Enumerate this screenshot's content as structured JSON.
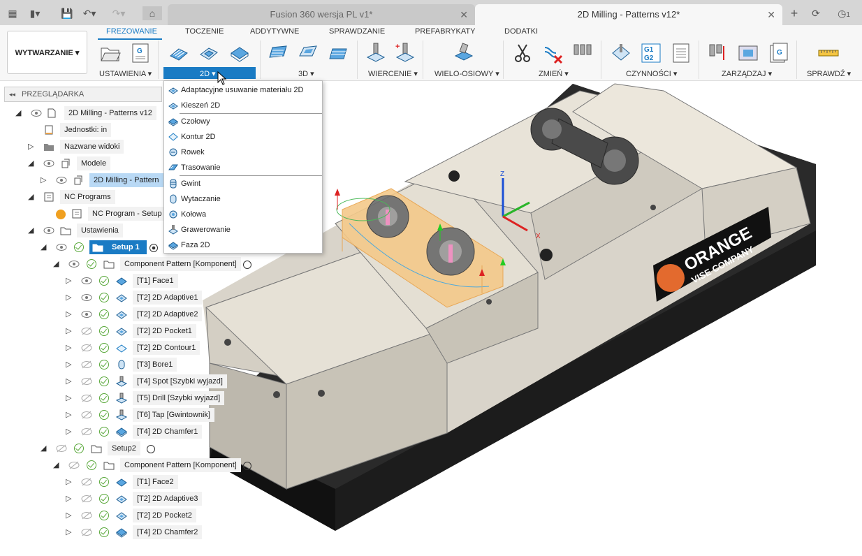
{
  "titlebar": {
    "tab1_title": "Fusion 360 wersja PL v1*",
    "tab2_title": "2D Milling - Patterns v12*",
    "notification_count": "1"
  },
  "workspace": {
    "label": "WYTWARZANIE"
  },
  "menu_tabs": [
    "FREZOWANIE",
    "TOCZENIE",
    "ADDYTYWNE",
    "SPRAWDZANIE",
    "PREFABRYKATY",
    "DODATKI"
  ],
  "groups": {
    "ustawienia": "USTAWIENIA",
    "g2d": "2D",
    "g3d": "3D",
    "wiercenie": "WIERCENIE",
    "wielo": "WIELO-OSIOWY",
    "zmien": "ZMIEŃ",
    "czynnosci": "CZYNNOŚCI",
    "zarzadzaj": "ZARZĄDZAJ",
    "sprawdz": "SPRAWDŹ"
  },
  "dropdown": [
    "Adaptacyjne usuwanie materiału 2D",
    "Kieszeń 2D",
    "Czołowy",
    "Kontur 2D",
    "Rowek",
    "Trasowanie",
    "Gwint",
    "Wytaczanie",
    "Kołowa",
    "Grawerowanie",
    "Faza 2D"
  ],
  "browser": {
    "header": "PRZEGLĄDARKA",
    "root": "2D Milling - Patterns v12",
    "units": "Jednostki: in",
    "named_views": "Nazwane widoki",
    "models": "Modele",
    "model_item": "2D Milling - Pattern",
    "nc_programs": "NC Programs",
    "nc_program": "NC Program - Setup 1",
    "setups": "Ustawienia",
    "setup1": "Setup 1",
    "pattern1": "Component Pattern [Komponent]",
    "ops1": [
      "[T1] Face1",
      "[T2] 2D Adaptive1",
      "[T2] 2D Adaptive2",
      "[T2] 2D Pocket1",
      "[T2] 2D Contour1",
      "[T3] Bore1",
      "[T4] Spot [Szybki wyjazd]",
      "[T5] Drill [Szybki wyjazd]",
      "[T6] Tap [Gwintownik]",
      "[T4] 2D Chamfer1"
    ],
    "setup2": "Setup2",
    "pattern2": "Component Pattern [Komponent]",
    "ops2": [
      "[T1] Face2",
      "[T2] 2D Adaptive3",
      "[T2] 2D Pocket2",
      "[T4] 2D Chamfer2"
    ]
  },
  "viewport": {
    "brand_line1": "ORANGE",
    "brand_line2": "VISE COMPANY",
    "axis_z": "Z",
    "axis_x": "X"
  },
  "colors": {
    "accent": "#1a7bc4",
    "highlight": "#b9d9f5",
    "vise_black": "#1c1c1c",
    "vise_beige": "#d9d4ca"
  }
}
